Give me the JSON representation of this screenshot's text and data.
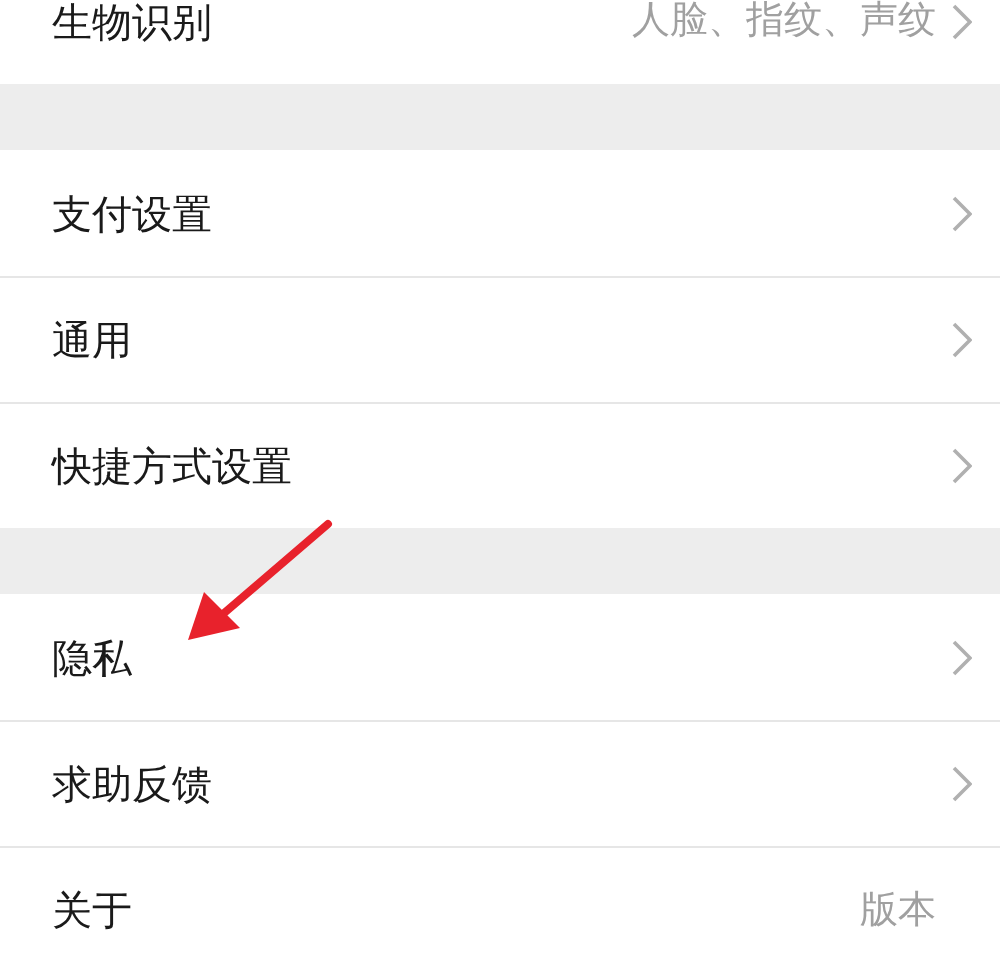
{
  "sections": [
    {
      "items": [
        {
          "label": "生物识别",
          "value": "人脸、指纹、声纹",
          "chevron": true
        }
      ]
    },
    {
      "items": [
        {
          "label": "支付设置",
          "chevron": true
        },
        {
          "label": "通用",
          "chevron": true
        },
        {
          "label": "快捷方式设置",
          "chevron": true
        }
      ]
    },
    {
      "items": [
        {
          "label": "隐私",
          "chevron": true
        },
        {
          "label": "求助反馈",
          "chevron": true
        },
        {
          "label": "关于",
          "value": "版本",
          "chevron": false
        }
      ]
    }
  ]
}
